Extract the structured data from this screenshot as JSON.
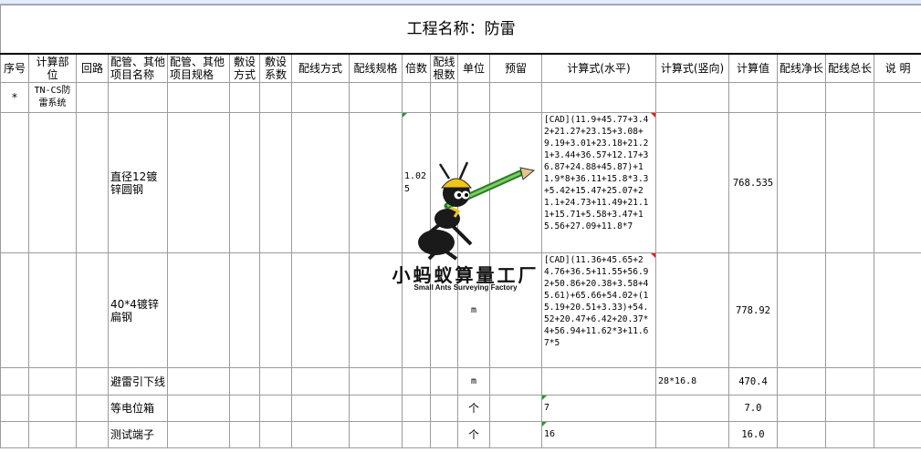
{
  "title": "工程名称：防雷",
  "headers": {
    "seq": "序号",
    "part": "计算部位",
    "loop": "回路",
    "item_name": "配管、其他项目名称",
    "item_spec": "配管、其他项目规格",
    "lay_method": "敷设方式",
    "lay_coef": "敷设系数",
    "wire_method": "配线方式",
    "wire_spec": "配线规格",
    "multiple": "倍数",
    "wire_count": "配线根数",
    "unit": "单位",
    "reserve": "预留",
    "formula_h": "计算式(水平)",
    "formula_v": "计算式(竖向)",
    "calc_value": "计算值",
    "net_length": "配线净长",
    "total_length": "配线总长",
    "note": "说 明"
  },
  "rows": [
    {
      "seq": "*",
      "part": "TN-CS防雷系统"
    },
    {
      "item_name": "直径12镀锌圆钢",
      "multiple": "1.025",
      "formula_h": "[CAD](11.9+45.77+3.42+21.27+23.15+3.08+9.19+3.01+23.18+21.21+3.44+36.57+12.17+36.87+24.88+45.87)+11.9*8+36.11+15.8*3.3+5.42+15.47+25.07+21.1+24.73+11.49+21.11+15.71+5.58+3.47+15.56+27.09+11.8*7",
      "calc_value": "768.535"
    },
    {
      "item_name": "40*4镀锌扁钢",
      "unit": "m",
      "formula_h": "[CAD](11.36+45.65+24.76+36.5+11.55+56.92+50.86+20.38+3.58+45.61)+65.66+54.02+(15.19+20.51+3.33)+54.52+20.47+6.42+20.37*4+56.94+11.62*3+11.67*5",
      "calc_value": "778.92"
    },
    {
      "item_name": "避雷引下线",
      "unit": "m",
      "formula_v": "28*16.8",
      "calc_value": "470.4"
    },
    {
      "item_name": "等电位箱",
      "unit": "个",
      "formula_h": "7",
      "calc_value": "7.0"
    },
    {
      "item_name": "测试端子",
      "unit": "个",
      "formula_h": "16",
      "calc_value": "16.0"
    }
  ],
  "logo": {
    "name_cn": "小蚂蚁算量工厂",
    "name_en": "Small Ants Surveying Factory"
  }
}
